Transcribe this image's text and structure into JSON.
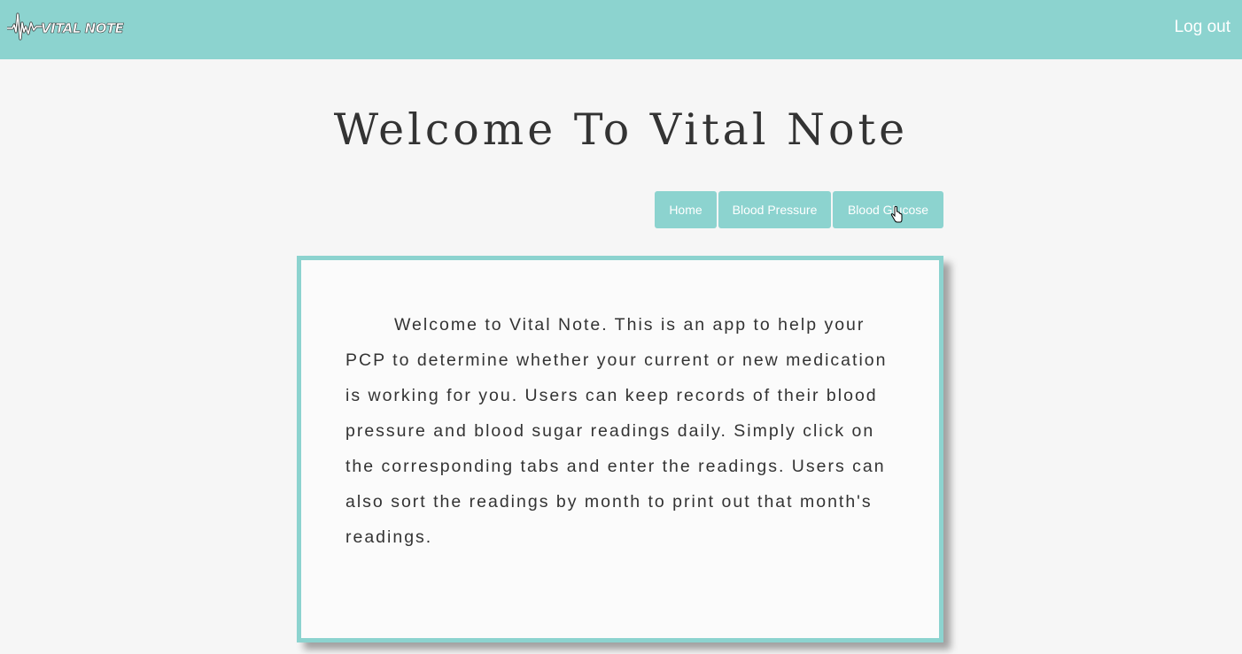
{
  "navbar": {
    "brand_text": "VITAL NOTE",
    "logout_label": "Log out"
  },
  "page": {
    "title": "Welcome To Vital Note"
  },
  "tabs": [
    {
      "label": "Home"
    },
    {
      "label": "Blood Pressure"
    },
    {
      "label": "Blood Glucose"
    }
  ],
  "intro": {
    "text": "Welcome to Vital Note. This is an app to help your PCP to determine whether your current or new medication is working for you. Users can keep records of their blood pressure and blood sugar readings daily. Simply click on the corresponding tabs and enter the readings. Users can also sort the readings by month to print out that month's readings."
  },
  "colors": {
    "accent": "#8cd3cf",
    "text": "#333333",
    "background": "#f6f6f6"
  },
  "icons": {
    "brand": "heartbeat-icon",
    "cursor": "pointer-cursor-icon"
  }
}
